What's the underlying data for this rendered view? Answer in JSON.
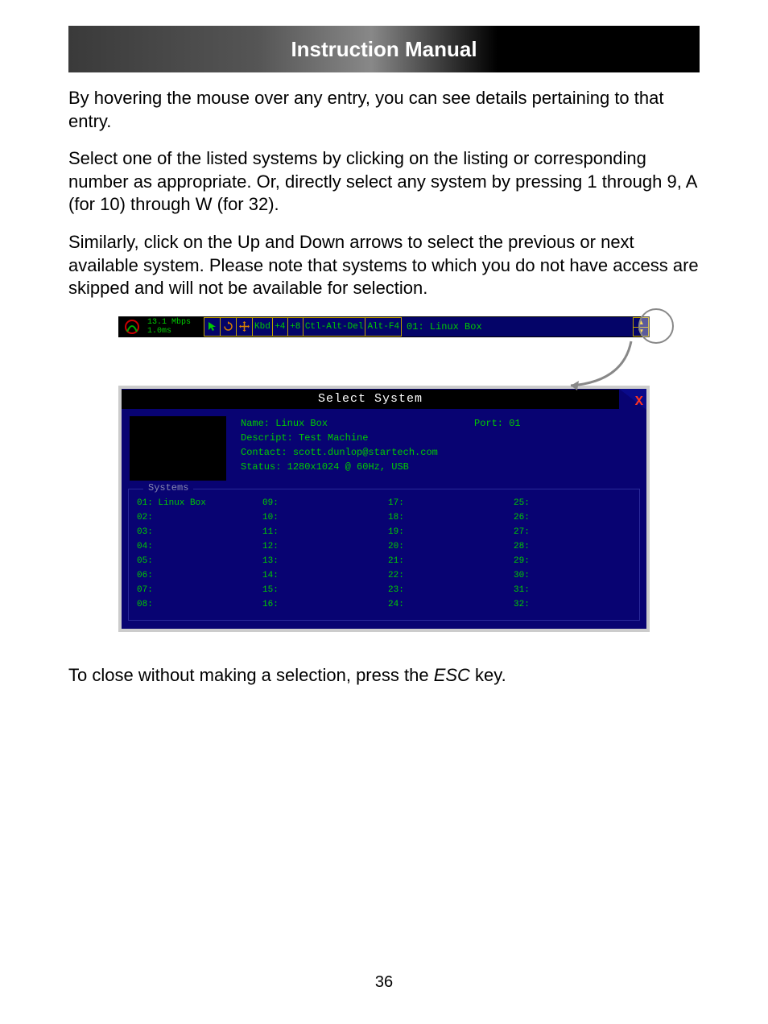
{
  "header": {
    "title": "Instruction Manual"
  },
  "paragraphs": {
    "p1": "By hovering the mouse over any entry, you can see details pertaining to that entry.",
    "p2": "Select one of the listed systems by clicking on the listing or corresponding number as appropriate.  Or, directly select any system by pressing 1 through 9, A (for 10) through W (for 32).",
    "p3": "Similarly, click on the Up and Down arrows to select the previous or next available system.  Please note that systems to which you do not have access are skipped and will not be available for selection.",
    "p4_pre": "To close without making a selection, press the ",
    "p4_esc": "ESC",
    "p4_post": " key."
  },
  "toolbar": {
    "rate_line1": "13.1 Mbps",
    "rate_line2": "1.0ms",
    "btn_kbd": "Kbd",
    "btn_plus4": "+4",
    "btn_plus8": "+8",
    "btn_ctlaltdel": "Ctl-Alt-Del",
    "btn_altf4": "Alt-F4",
    "current": "01: Linux Box",
    "up": "▲",
    "down": "▼"
  },
  "dialog": {
    "title": "Select System",
    "close": "X",
    "name_label": "Name:",
    "name_value": "Linux Box",
    "port_label": "Port:",
    "port_value": "01",
    "descript_label": "Descript:",
    "descript_value": "Test Machine",
    "contact_label": "Contact:",
    "contact_value": "scott.dunlop@startech.com",
    "status_label": "Status:",
    "status_value": "1280x1024 @ 60Hz, USB",
    "systems_legend": "Systems",
    "systems": [
      "01: Linux Box",
      "02:",
      "03:",
      "04:",
      "05:",
      "06:",
      "07:",
      "08:",
      "09:",
      "10:",
      "11:",
      "12:",
      "13:",
      "14:",
      "15:",
      "16:",
      "17:",
      "18:",
      "19:",
      "20:",
      "21:",
      "22:",
      "23:",
      "24:",
      "25:",
      "26:",
      "27:",
      "28:",
      "29:",
      "30:",
      "31:",
      "32:"
    ]
  },
  "page_number": "36"
}
